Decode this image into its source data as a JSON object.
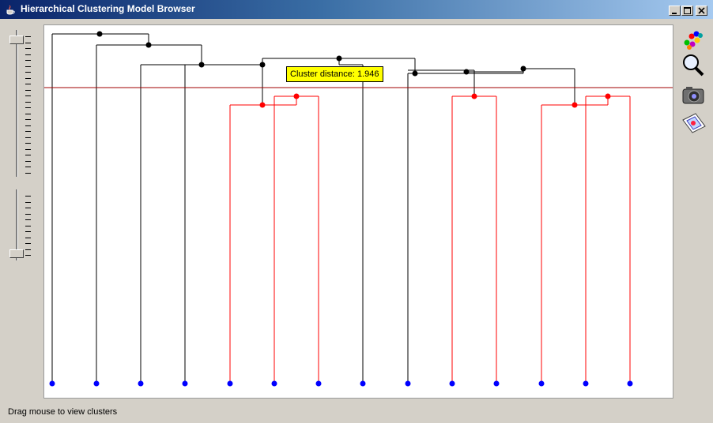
{
  "window": {
    "title": "Hierarchical Clustering Model Browser",
    "controls": [
      "minimize",
      "maximize",
      "close"
    ]
  },
  "canvas": {
    "tooltip": "Cluster distance: 1.946",
    "leaf_color": "#0000ff",
    "cut_line_color": "#a00000",
    "cluster_color": "#ff0000",
    "tree_color": "#000000"
  },
  "toolbar": {
    "tools": [
      {
        "name": "clusters-tool-icon"
      },
      {
        "name": "zoom-magnifier-icon"
      },
      {
        "name": "camera-snapshot-icon"
      },
      {
        "name": "export-image-icon"
      }
    ]
  },
  "status": {
    "text": "Drag mouse to view clusters"
  }
}
